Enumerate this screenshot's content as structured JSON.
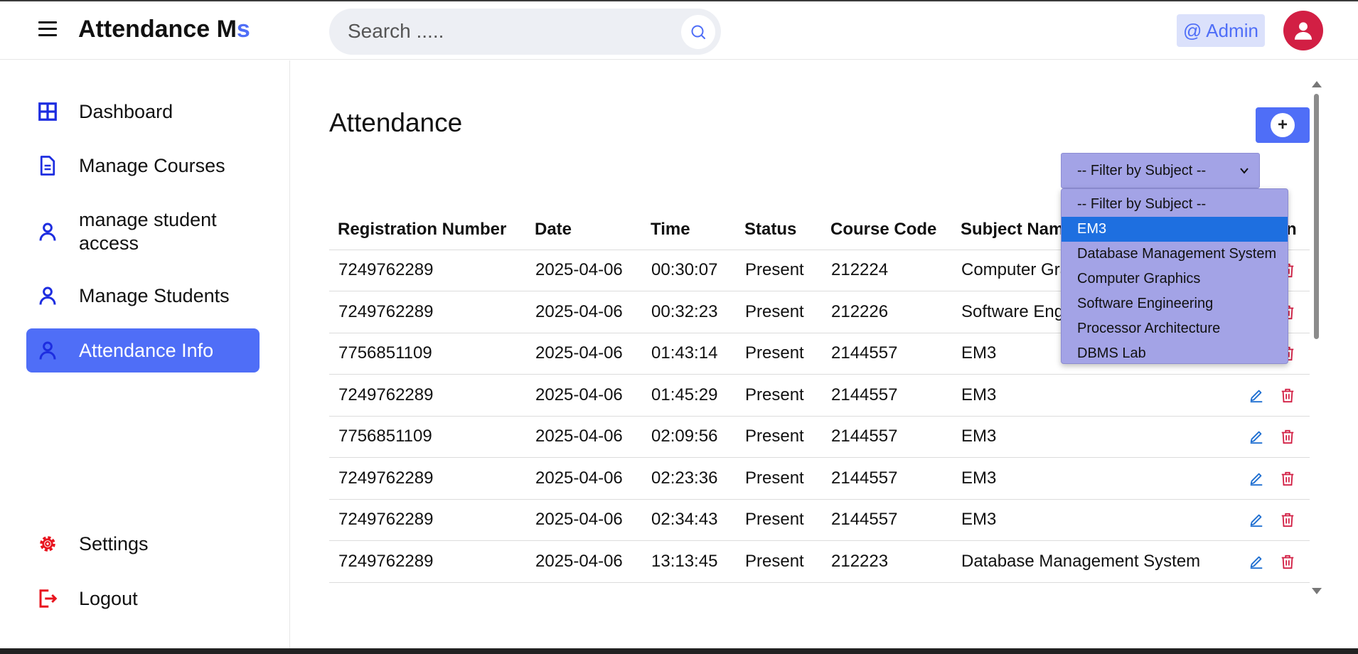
{
  "app": {
    "brand_main": "Attendance M",
    "brand_accent": "s",
    "accent_color": "#4f6ef7"
  },
  "header": {
    "search_placeholder": "Search .....",
    "admin_label": "@ Admin"
  },
  "sidebar": {
    "items": [
      {
        "label": "Dashboard",
        "icon": "grid-icon"
      },
      {
        "label": "Manage Courses",
        "icon": "document-icon"
      },
      {
        "label": "manage student access",
        "icon": "user-icon"
      },
      {
        "label": "Manage Students",
        "icon": "user-icon"
      },
      {
        "label": "Attendance Info",
        "icon": "user-icon",
        "active": true
      }
    ],
    "bottom_items": [
      {
        "label": "Settings",
        "icon": "gear-icon"
      },
      {
        "label": "Logout",
        "icon": "logout-icon"
      }
    ]
  },
  "main": {
    "title": "Attendance",
    "filter": {
      "selected": "-- Filter by Subject --",
      "options": [
        "-- Filter by Subject --",
        "EM3",
        "Database Management System",
        "Computer Graphics",
        "Software Engineering",
        "Processor Architecture",
        "DBMS Lab"
      ],
      "highlighted": "EM3"
    },
    "table": {
      "headers": [
        "Registration Number",
        "Date",
        "Time",
        "Status",
        "Course Code",
        "Subject Name",
        "Action"
      ],
      "rows": [
        [
          "7249762289",
          "2025-04-06",
          "00:30:07",
          "Present",
          "212224",
          "Computer Graphics"
        ],
        [
          "7249762289",
          "2025-04-06",
          "00:32:23",
          "Present",
          "212226",
          "Software Engineering"
        ],
        [
          "7756851109",
          "2025-04-06",
          "01:43:14",
          "Present",
          "2144557",
          "EM3"
        ],
        [
          "7249762289",
          "2025-04-06",
          "01:45:29",
          "Present",
          "2144557",
          "EM3"
        ],
        [
          "7756851109",
          "2025-04-06",
          "02:09:56",
          "Present",
          "2144557",
          "EM3"
        ],
        [
          "7249762289",
          "2025-04-06",
          "02:23:36",
          "Present",
          "2144557",
          "EM3"
        ],
        [
          "7249762289",
          "2025-04-06",
          "02:34:43",
          "Present",
          "2144557",
          "EM3"
        ],
        [
          "7249762289",
          "2025-04-06",
          "13:13:45",
          "Present",
          "212223",
          "Database Management System"
        ]
      ]
    }
  }
}
